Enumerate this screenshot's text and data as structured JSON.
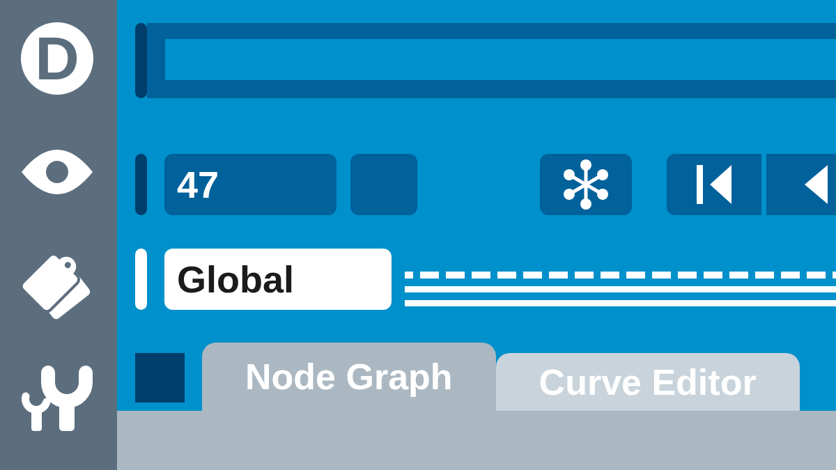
{
  "sidebar": {
    "logo": "D"
  },
  "toolbar": {
    "frame_field": {
      "value": "47"
    }
  },
  "layer_field": {
    "value": "Global"
  },
  "tabs": [
    {
      "label": "Node Graph",
      "selected": true
    },
    {
      "label": "Curve Editor",
      "selected": false
    }
  ]
}
